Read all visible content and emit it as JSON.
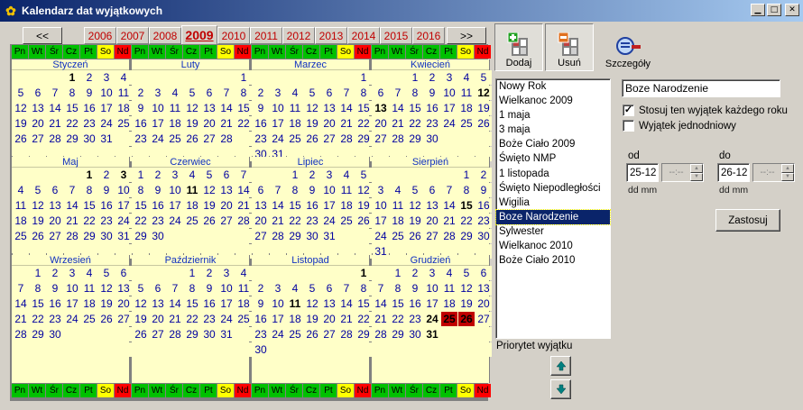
{
  "window": {
    "title": "Kalendarz dat wyjątkowych",
    "minimize_icon": "minimize-icon",
    "maximize_icon": "maximize-icon",
    "close_icon": "close-icon"
  },
  "calendar": {
    "prev_label": "<<",
    "next_label": ">>",
    "years": [
      "2006",
      "2007",
      "2008",
      "2009",
      "2010",
      "2011",
      "2012",
      "2013",
      "2014",
      "2015",
      "2016"
    ],
    "selected_year": "2009",
    "weekdays": [
      "Pn",
      "Wt",
      "Śr",
      "Cz",
      "Pt",
      "So",
      "Nd"
    ],
    "weekday_colors": {
      "workday": "#00c000",
      "saturday": "#ffff00",
      "sunday": "#ff0000"
    },
    "holiday_color": "#c00000",
    "months": [
      {
        "name": "Styczeń",
        "start": 3,
        "days": 31,
        "bold": [
          1
        ],
        "holiday": []
      },
      {
        "name": "Luty",
        "start": 6,
        "days": 28,
        "bold": [],
        "holiday": []
      },
      {
        "name": "Marzec",
        "start": 6,
        "days": 31,
        "bold": [],
        "holiday": []
      },
      {
        "name": "Kwiecień",
        "start": 2,
        "days": 30,
        "bold": [
          12,
          13
        ],
        "holiday": []
      },
      {
        "name": "Maj",
        "start": 4,
        "days": 31,
        "bold": [
          1,
          3
        ],
        "holiday": []
      },
      {
        "name": "Czerwiec",
        "start": 0,
        "days": 30,
        "bold": [
          11
        ],
        "holiday": []
      },
      {
        "name": "Lipiec",
        "start": 2,
        "days": 31,
        "bold": [],
        "holiday": []
      },
      {
        "name": "Sierpień",
        "start": 5,
        "days": 31,
        "bold": [
          15
        ],
        "holiday": []
      },
      {
        "name": "Wrzesień",
        "start": 1,
        "days": 30,
        "bold": [],
        "holiday": []
      },
      {
        "name": "Październik",
        "start": 3,
        "days": 31,
        "bold": [],
        "holiday": []
      },
      {
        "name": "Listopad",
        "start": 6,
        "days": 30,
        "bold": [
          1,
          11
        ],
        "holiday": []
      },
      {
        "name": "Grudzień",
        "start": 1,
        "days": 31,
        "bold": [
          24,
          31
        ],
        "holiday": [
          25,
          26
        ]
      }
    ]
  },
  "toolbar": {
    "add_label": "Dodaj",
    "remove_label": "Usuń",
    "details_label": "Szczegóły"
  },
  "exceptions": {
    "items": [
      "Nowy Rok",
      "Wielkanoc 2009",
      "1 maja",
      "3 maja",
      "Boże Ciało 2009",
      "Święto NMP",
      "1 listopada",
      "Święto Niepodległości",
      "Wigilia",
      "Boze Narodzenie",
      "Sylwester",
      "Wielkanoc 2010",
      "Boże Ciało 2010"
    ],
    "selected": "Boze Narodzenie",
    "priority_label": "Priorytet wyjątku"
  },
  "details": {
    "name_value": "Boze Narodzenie",
    "apply_every_year_label": "Stosuj ten wyjątek każdego roku",
    "apply_every_year_checked": true,
    "single_day_label": "Wyjątek jednodniowy",
    "single_day_checked": false,
    "from_label": "od",
    "from_value": "25-12",
    "from_hint": "dd mm",
    "from_time": "--:--",
    "to_label": "do",
    "to_value": "26-12",
    "to_hint": "dd mm",
    "to_time": "--:--",
    "apply_label": "Zastosuj"
  }
}
